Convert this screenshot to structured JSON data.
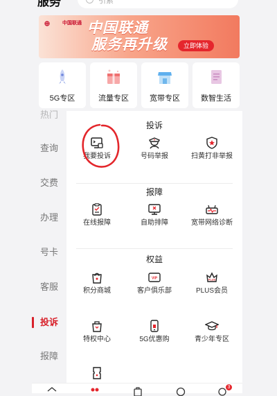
{
  "header": {
    "title": "服务",
    "search_placeholder": "引索"
  },
  "banner": {
    "brand": "中国联通",
    "line1": "中国联通",
    "line2": "服务再升级",
    "cta": "立即体验",
    "colors": {
      "cta": "#e5262d",
      "brand": "#c8102e"
    }
  },
  "quick_entries": [
    {
      "label": "5G专区",
      "icon": "rocket-icon"
    },
    {
      "label": "流量专区",
      "icon": "gift-box-icon"
    },
    {
      "label": "宽带专区",
      "icon": "shop-icon"
    },
    {
      "label": "数智生活",
      "icon": "document-icon"
    }
  ],
  "sidebar": {
    "items": [
      {
        "label": "热门"
      },
      {
        "label": "查询"
      },
      {
        "label": "交费"
      },
      {
        "label": "办理"
      },
      {
        "label": "号卡"
      },
      {
        "label": "客服"
      },
      {
        "label": "投诉",
        "active": true
      },
      {
        "label": "报障"
      }
    ],
    "accent": "#d8202a"
  },
  "sections": [
    {
      "title": "投诉",
      "items": [
        {
          "label": "我要投诉",
          "icon": "complaint-monitor-icon"
        },
        {
          "label": "号码举报",
          "icon": "officer-icon"
        },
        {
          "label": "扫黄打非举报",
          "icon": "shield-star-icon"
        }
      ]
    },
    {
      "title": "报障",
      "items": [
        {
          "label": "在线报障",
          "icon": "clipboard-icon"
        },
        {
          "label": "自助排障",
          "icon": "monitor-tool-icon"
        },
        {
          "label": "宽带网络诊断",
          "icon": "router-pulse-icon"
        }
      ]
    },
    {
      "title": "权益",
      "items": [
        {
          "label": "积分商城",
          "icon": "shopping-bag-icon"
        },
        {
          "label": "客户俱乐部",
          "icon": "vip-card-icon"
        },
        {
          "label": "PLUS会员",
          "icon": "crown-icon"
        }
      ]
    },
    {
      "title": "",
      "items": [
        {
          "label": "特权中心",
          "icon": "privilege-bag-icon"
        },
        {
          "label": "5G优惠购",
          "icon": "phone-icon"
        },
        {
          "label": "青少年专区",
          "icon": "graduation-cap-icon"
        }
      ]
    },
    {
      "title": "",
      "items": [
        {
          "label": "",
          "icon": "ticket-icon"
        }
      ]
    }
  ],
  "tabbar": {
    "badge": "3"
  }
}
